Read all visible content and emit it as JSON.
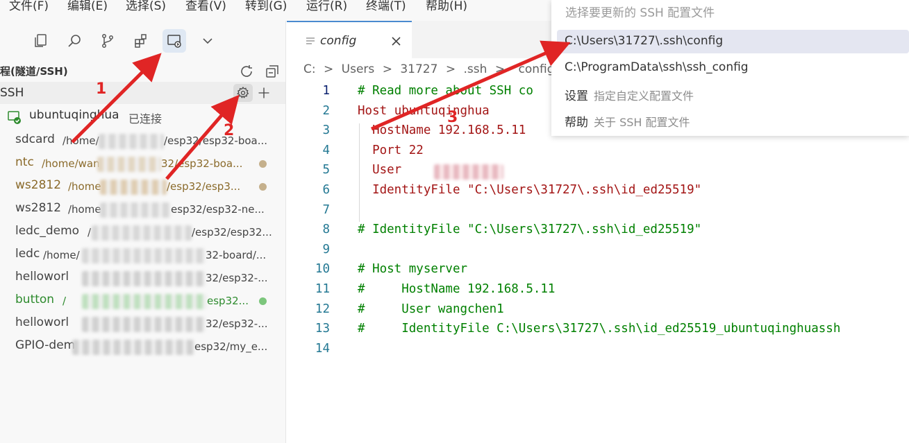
{
  "menu": [
    "文件(F)",
    "编辑(E)",
    "选择(S)",
    "查看(V)",
    "转到(G)",
    "运行(R)",
    "终端(T)",
    "帮助(H)"
  ],
  "sidebar": {
    "title": "程(隧道/SSH)",
    "section_label": "SSH",
    "connected_host": {
      "name": "ubuntuqinghua",
      "status": "已连接"
    },
    "folders": [
      {
        "name": "sdcard",
        "path": "/home/",
        "path_end": "/esp32/esp32-boa...",
        "color": "#444444",
        "dot": ""
      },
      {
        "name": "ntc",
        "path": "/home/wan",
        "path_end": "32/esp32-boa...",
        "color": "#8a6a2a",
        "dot": "#c5b08c"
      },
      {
        "name": "ws2812",
        "path": "/home",
        "path_end": "/esp32/esp3...",
        "color": "#8a6a2a",
        "dot": "#c5b08c"
      },
      {
        "name": "ws2812",
        "path": "/home",
        "path_end": "esp32/esp32-ne...",
        "color": "#444444",
        "dot": ""
      },
      {
        "name": "ledc_demo",
        "path": "/",
        "path_end": "/esp32/esp32...",
        "color": "#444444",
        "dot": ""
      },
      {
        "name": "ledc",
        "path": "/home/",
        "path_end": "32-board/...",
        "color": "#444444",
        "dot": ""
      },
      {
        "name": "helloworl",
        "path": "",
        "path_end": "32/esp32-...",
        "color": "#444444",
        "dot": ""
      },
      {
        "name": "button",
        "path": "/",
        "path_end": "esp32...",
        "color": "#2e8b2e",
        "dot": "#7cc67c"
      },
      {
        "name": "helloworl",
        "path": "",
        "path_end": "32/esp32-...",
        "color": "#444444",
        "dot": ""
      },
      {
        "name": "GPIO-dem",
        "path": "",
        "path_end": "esp32/my_e...",
        "color": "#444444",
        "dot": ""
      }
    ]
  },
  "editor": {
    "tab_label": "config",
    "breadcrumb": {
      "c": "C:",
      "users": "Users",
      "id": "31727",
      "ssh": ".ssh",
      "file": "config"
    },
    "lines": [
      {
        "n": "1",
        "text": "# Read more about SSH co",
        "kind": "cm"
      },
      {
        "n": "2",
        "kw": "Host",
        "val": " ubuntuqinghua"
      },
      {
        "n": "3",
        "kw": "  HostName",
        "val": " 192.168.5.11"
      },
      {
        "n": "4",
        "kw": "  Port",
        "val": " 22"
      },
      {
        "n": "5",
        "kw": "  User",
        "val": ""
      },
      {
        "n": "6",
        "kw": "  IdentityFile",
        "val": " \"C:\\Users\\31727\\.ssh\\id_ed25519\""
      },
      {
        "n": "7",
        "text": "",
        "kind": "cm"
      },
      {
        "n": "8",
        "text": "# IdentityFile \"C:\\Users\\31727\\.ssh\\id_ed25519\"",
        "kind": "cm"
      },
      {
        "n": "9",
        "text": "",
        "kind": "cm"
      },
      {
        "n": "10",
        "text": "# Host myserver",
        "kind": "cm"
      },
      {
        "n": "11",
        "text": "#     HostName 192.168.5.11",
        "kind": "cm"
      },
      {
        "n": "12",
        "text": "#     User wangchen1",
        "kind": "cm"
      },
      {
        "n": "13",
        "text": "#     IdentityFile C:\\Users\\31727\\.ssh\\id_ed25519_ubuntuqinghuassh",
        "kind": "cm"
      },
      {
        "n": "14",
        "text": "",
        "kind": "cm"
      }
    ]
  },
  "quickpick": {
    "placeholder": "选择要更新的 SSH 配置文件",
    "items": [
      {
        "label": "C:\\Users\\31727\\.ssh\\config",
        "desc": ""
      },
      {
        "label": "C:\\ProgramData\\ssh\\ssh_config",
        "desc": ""
      },
      {
        "label": "设置",
        "desc": "指定自定义配置文件"
      },
      {
        "label": "帮助",
        "desc": "关于 SSH 配置文件"
      }
    ]
  },
  "annotations": [
    "1",
    "2",
    "3"
  ],
  "colors": {
    "arrow": "#e02525",
    "accent": "#4a8ad0",
    "keyword": "#a31515",
    "value": "#0451a5",
    "comment": "#008000"
  }
}
